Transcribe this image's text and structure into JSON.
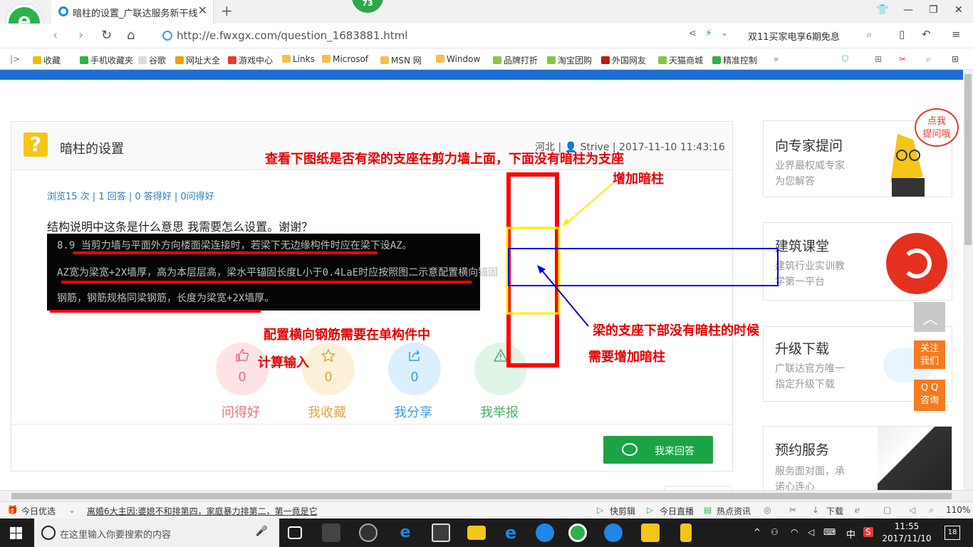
{
  "browser": {
    "tab_title": "暗柱的设置_广联达服务新干线",
    "badge_count": "73",
    "url": "http://e.fwxgx.com/question_1683881.html",
    "promo_text": "双11买家电享6期免息"
  },
  "bookmarks": [
    "收藏",
    "手机收藏夹",
    "谷歌",
    "网址大全",
    "游戏中心",
    "Links",
    "Microsof",
    "MSN 网",
    "Window",
    "品牌打折",
    "淘宝团购",
    "外国网友",
    "天猫商城",
    "精准控制"
  ],
  "question": {
    "title": "暗柱的设置",
    "region": "河北",
    "user": "Strive",
    "datetime": "2017-11-10 11:43:16",
    "stats": "浏览15 次 | 1 回答 | 0 答得好 | 0问得好",
    "description": "结构说明中这条是什么意思 我需要怎么设置。谢谢？",
    "image_lines": [
      "8.9 当剪力墙与平面外方向楼面梁连接时，若梁下无边缘构件时应在梁下设AZ。",
      "AZ宽为梁宽+2X墙厚，高为本层层高，梁水平锚固长度L小于0.4LaE时应按照图二示意配置横向锚固",
      "钢筋，钢筋规格同梁钢筋，长度为梁宽+2X墙厚。"
    ]
  },
  "actions": [
    {
      "label": "问得好",
      "count": "0",
      "color": "#e8707f",
      "bg": "#fde3e6"
    },
    {
      "label": "我收藏",
      "count": "0",
      "color": "#e0a53c",
      "bg": "#fdf0d8"
    },
    {
      "label": "我分享",
      "count": "0",
      "color": "#3b9be0",
      "bg": "#dcefff"
    },
    {
      "label": "我举报",
      "count": "0",
      "color": "#4cae6a",
      "bg": "#e1f5e6"
    }
  ],
  "answer_button": "我来回答",
  "annotations": {
    "top_line1": "查看下图纸是否有梁的支座在剪力墙上面，下面没有暗柱为支座",
    "top_line2": "增加暗柱",
    "left_line1": "配置横向钢筋需要在单构件中",
    "left_line2": "计算输入",
    "right_line1": "梁的支座下部没有暗柱的时候",
    "right_line2": "需要增加暗柱"
  },
  "sidebar": {
    "ask_expert": {
      "title": "向专家提问",
      "desc1": "业界最权威专家",
      "desc2": "为您解答",
      "bubble": "点我\n提问哦"
    },
    "course": {
      "title": "建筑课堂",
      "desc1": "建筑行业实训教",
      "desc2": "学第一平台"
    },
    "upgrade": {
      "title": "升级下载",
      "desc1": "广联达官方唯一",
      "desc2": "指定升级下载"
    },
    "booking": {
      "title": "预约服务",
      "desc1": "服务面对面，承",
      "desc2": "诺心连心"
    },
    "follow": "关注\n我们",
    "qq": "Q Q\n咨询"
  },
  "statusbar": {
    "left": "今日优选",
    "news": "离婚6大主因:婆媳不和排第四，家庭暴力排第二，第一竟是它",
    "items": [
      "快剪辑",
      "今日直播",
      "热点资讯",
      "下载"
    ],
    "zoom": "110%"
  },
  "taskbar": {
    "search_placeholder": "在这里输入你要搜索的内容",
    "time": "11:55",
    "date": "2017/11/10",
    "ime": "中",
    "notif_count": "18"
  }
}
